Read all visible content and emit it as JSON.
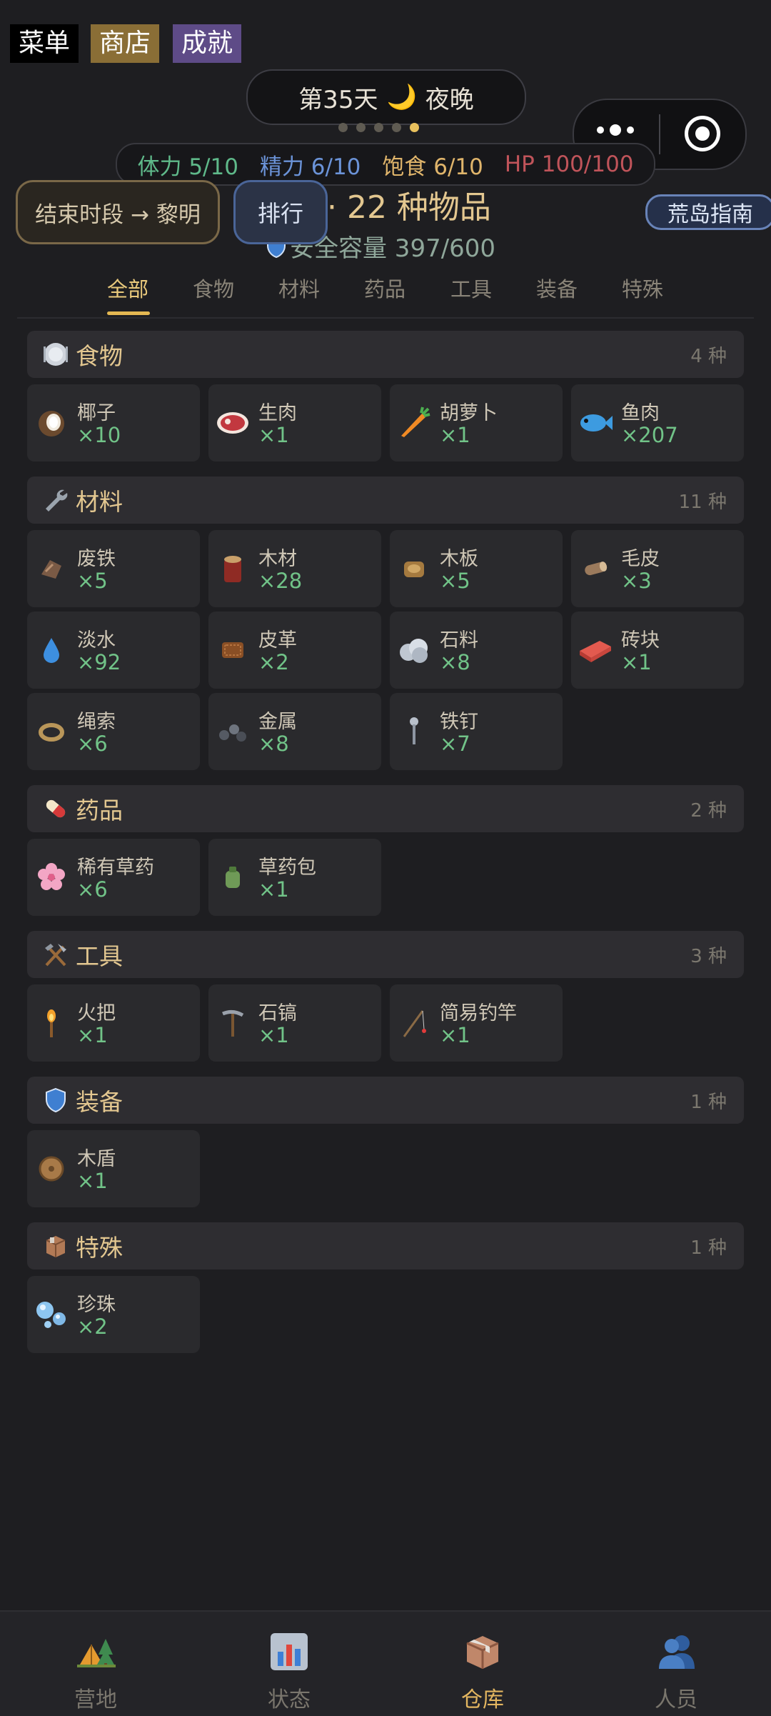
{
  "top_menu": {
    "menu": "菜单",
    "shop": "商店",
    "achievements": "成就"
  },
  "day": {
    "label": "第35天",
    "period": "夜晚",
    "moon": "🌙"
  },
  "stats": {
    "stamina": "体力 5/10",
    "energy": "精力 6/10",
    "hunger": "饱食 6/10",
    "hp": "HP 100/100"
  },
  "end_period_button": "结束时段 → 黎明",
  "rank_button": "排行",
  "guide_button": "荒岛指南",
  "warehouse": {
    "title": "仓库 · 22 种物品",
    "capacity": "安全容量 397/600"
  },
  "tabs": [
    "全部",
    "食物",
    "材料",
    "药品",
    "工具",
    "装备",
    "特殊"
  ],
  "sections": {
    "food": {
      "title": "食物",
      "count": "4 种",
      "items": [
        {
          "name": "椰子",
          "qty": "×10"
        },
        {
          "name": "生肉",
          "qty": "×1"
        },
        {
          "name": "胡萝卜",
          "qty": "×1"
        },
        {
          "name": "鱼肉",
          "qty": "×207"
        }
      ]
    },
    "material": {
      "title": "材料",
      "count": "11 种",
      "items": [
        {
          "name": "废铁",
          "qty": "×5"
        },
        {
          "name": "木材",
          "qty": "×28"
        },
        {
          "name": "木板",
          "qty": "×5"
        },
        {
          "name": "毛皮",
          "qty": "×3"
        },
        {
          "name": "淡水",
          "qty": "×92"
        },
        {
          "name": "皮革",
          "qty": "×2"
        },
        {
          "name": "石料",
          "qty": "×8"
        },
        {
          "name": "砖块",
          "qty": "×1"
        },
        {
          "name": "绳索",
          "qty": "×6"
        },
        {
          "name": "金属",
          "qty": "×8"
        },
        {
          "name": "铁钉",
          "qty": "×7"
        }
      ]
    },
    "medicine": {
      "title": "药品",
      "count": "2 种",
      "items": [
        {
          "name": "稀有草药",
          "qty": "×6"
        },
        {
          "name": "草药包",
          "qty": "×1"
        }
      ]
    },
    "tool": {
      "title": "工具",
      "count": "3 种",
      "items": [
        {
          "name": "火把",
          "qty": "×1"
        },
        {
          "name": "石镐",
          "qty": "×1"
        },
        {
          "name": "简易钓竿",
          "qty": "×1"
        }
      ]
    },
    "equip": {
      "title": "装备",
      "count": "1 种",
      "items": [
        {
          "name": "木盾",
          "qty": "×1"
        }
      ]
    },
    "special": {
      "title": "特殊",
      "count": "1 种",
      "items": [
        {
          "name": "珍珠",
          "qty": "×2"
        }
      ]
    }
  },
  "nav": [
    "营地",
    "状态",
    "仓库",
    "人员"
  ],
  "colors": {
    "accent": "#e4b852",
    "qty": "#71c388",
    "section_title": "#e3c790"
  }
}
